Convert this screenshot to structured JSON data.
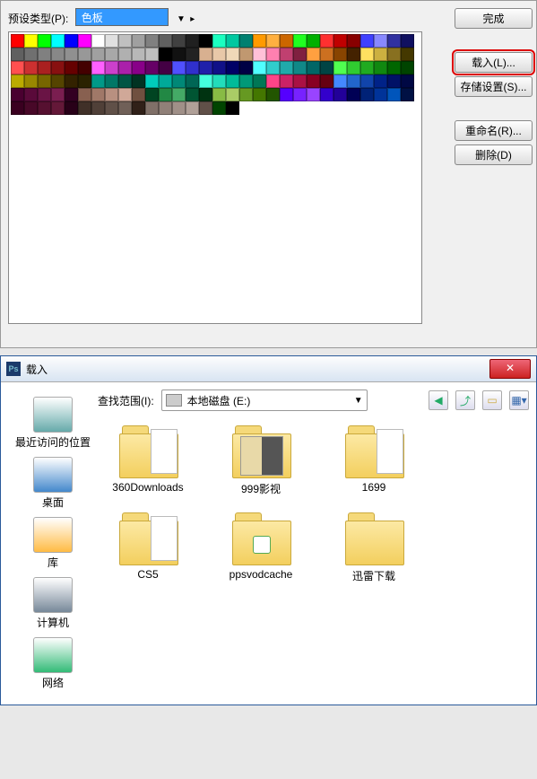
{
  "preset": {
    "label": "预设类型(P):",
    "value": "色板"
  },
  "buttons": {
    "done": "完成",
    "load": "载入(L)...",
    "save": "存储设置(S)...",
    "rename": "重命名(R)...",
    "delete": "删除(D)"
  },
  "swatch_colors": [
    "#ff0000",
    "#ffff00",
    "#00ff00",
    "#00ffff",
    "#0000ff",
    "#ff00ff",
    "#ffffff",
    "#e0e0e0",
    "#c0c0c0",
    "#a0a0a0",
    "#808080",
    "#606060",
    "#404040",
    "#202020",
    "#000000",
    "#1bffc0",
    "#00c8a0",
    "#008070",
    "#ff9a00",
    "#ffb040",
    "#cc6600",
    "#20ff20",
    "#00b000",
    "#ff3030",
    "#c00000",
    "#880000",
    "#4040ff",
    "#8888ff",
    "#3030a0",
    "#101060",
    "#606060",
    "#707070",
    "#808080",
    "#888888",
    "#909090",
    "#989898",
    "#a0a0a0",
    "#a8a8a8",
    "#b0b0b0",
    "#b8b8b8",
    "#c0c0c0",
    "#000000",
    "#111111",
    "#222222",
    "#d8b090",
    "#e8c8a8",
    "#f0d8b8",
    "#c09870",
    "#ffc0d8",
    "#ff80b0",
    "#c04070",
    "#802040",
    "#ffa040",
    "#cc7020",
    "#884400",
    "#442200",
    "#ffe060",
    "#ccb040",
    "#887020",
    "#443800",
    "#ff5050",
    "#cc3030",
    "#aa2020",
    "#881010",
    "#660000",
    "#440000",
    "#ff60ff",
    "#cc40cc",
    "#aa20aa",
    "#880088",
    "#660066",
    "#440044",
    "#5050ff",
    "#3030cc",
    "#2020aa",
    "#101088",
    "#000066",
    "#000044",
    "#50ffff",
    "#30cccc",
    "#20aaaa",
    "#108888",
    "#006666",
    "#004444",
    "#50ff50",
    "#30cc30",
    "#20aa20",
    "#108810",
    "#006600",
    "#004400",
    "#bbaa00",
    "#998800",
    "#776600",
    "#554400",
    "#332200",
    "#2a2200",
    "#009988",
    "#007766",
    "#005544",
    "#003322",
    "#00ccbb",
    "#00aa99",
    "#008877",
    "#006655",
    "#44ffdd",
    "#22ddbb",
    "#00bb99",
    "#009977",
    "#007755",
    "#ff4488",
    "#cc2266",
    "#aa1144",
    "#880022",
    "#660011",
    "#4488ff",
    "#2266cc",
    "#1144aa",
    "#002288",
    "#001166",
    "#000844",
    "#4a0030",
    "#5a0a3a",
    "#6a1445",
    "#7a1e50",
    "#330022",
    "#886050",
    "#a07868",
    "#b89080",
    "#d0a898",
    "#705040",
    "#004422",
    "#228844",
    "#44aa66",
    "#005533",
    "#003311",
    "#88bb44",
    "#aacc66",
    "#669922",
    "#447700",
    "#225500",
    "#5500ff",
    "#7722ff",
    "#9944ff",
    "#3300cc",
    "#220099",
    "#000055",
    "#002277",
    "#003399",
    "#0055bb",
    "#001144",
    "#3a0020",
    "#480828",
    "#561030",
    "#641838",
    "#280018",
    "#403028",
    "#504038",
    "#605048",
    "#706058",
    "#302018",
    "#807068",
    "#908078",
    "#a09088",
    "#b0a098",
    "#605048",
    "#004400",
    "#000000"
  ],
  "dialog": {
    "title": "载入",
    "lookin_label": "查找范围(I):",
    "lookin_value": "本地磁盘 (E:)"
  },
  "sidebar": [
    {
      "name": "recent",
      "label": "最近访问的位置"
    },
    {
      "name": "desktop",
      "label": "桌面"
    },
    {
      "name": "libraries",
      "label": "库"
    },
    {
      "name": "computer",
      "label": "计算机"
    },
    {
      "name": "network",
      "label": "网络"
    }
  ],
  "files": [
    {
      "name": "360Downloads",
      "type": "folder-paper"
    },
    {
      "name": "999影视",
      "type": "folder-thumb"
    },
    {
      "name": "1699",
      "type": "folder-paper"
    },
    {
      "name": "CS5",
      "type": "folder-paper"
    },
    {
      "name": "ppsvodcache",
      "type": "folder-icon"
    },
    {
      "name": "迅雷下载",
      "type": "folder"
    }
  ]
}
